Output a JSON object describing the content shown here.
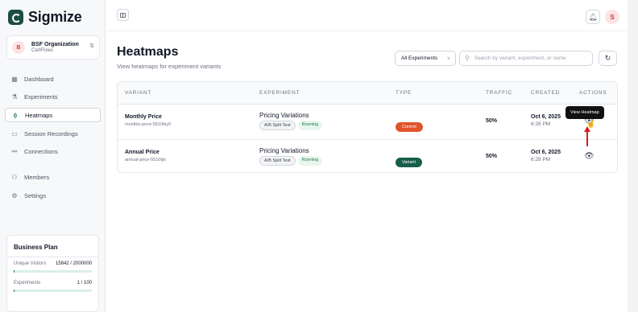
{
  "app": {
    "name": "Sigmize"
  },
  "org": {
    "initial": "B",
    "name": "BSF Organization",
    "sub": "CartFlows"
  },
  "sidebar": {
    "items": [
      {
        "label": "Dashboard",
        "icon": "grid-icon"
      },
      {
        "label": "Experiments",
        "icon": "flask-icon"
      },
      {
        "label": "Heatmaps",
        "icon": "flame-icon",
        "active": true
      },
      {
        "label": "Session Recordings",
        "icon": "video-icon"
      },
      {
        "label": "Connections",
        "icon": "plug-icon"
      },
      {
        "label": "Members",
        "icon": "users-icon"
      },
      {
        "label": "Settings",
        "icon": "gear-icon"
      }
    ]
  },
  "plan": {
    "title": "Business Plan",
    "visitors_label": "Unique Visitors",
    "visitors_value": "15842 / 2000000",
    "visitors_fraction": 0.0079,
    "experiments_label": "Experiments",
    "experiments_value": "1 / 100",
    "experiments_fraction": 0.01
  },
  "topbar": {
    "user_initial": "S"
  },
  "page": {
    "title": "Heatmaps",
    "subtitle": "View heatmaps for experiment variants"
  },
  "filters": {
    "experiment_select": "All Experiments",
    "search_placeholder": "Search by variant, experiment, or name"
  },
  "table": {
    "headers": [
      "VARIANT",
      "EXPERIMENT",
      "TYPE",
      "TRAFFIC",
      "CREATED",
      "ACTIONS"
    ],
    "rows": [
      {
        "variant": "Monthly Price",
        "slug": "monthly-price-5510bly0",
        "experiment": "Pricing Variations",
        "split": "A/B Split Test",
        "status": "Running",
        "type": "Control",
        "traffic": "50%",
        "date": "Oct 6, 2025",
        "time": "6:28 PM"
      },
      {
        "variant": "Annual Price",
        "slug": "annual-price-5510tjls",
        "experiment": "Pricing Variations",
        "split": "A/B Split Test",
        "status": "Running",
        "type": "Variant",
        "traffic": "50%",
        "date": "Oct 6, 2025",
        "time": "6:28 PM"
      }
    ]
  },
  "tooltip": {
    "text": "View Heatmap"
  },
  "colors": {
    "accent": "#1d6b58",
    "control": "#e0542c",
    "variant": "#175e4b",
    "annotation": "#d91c1c"
  }
}
